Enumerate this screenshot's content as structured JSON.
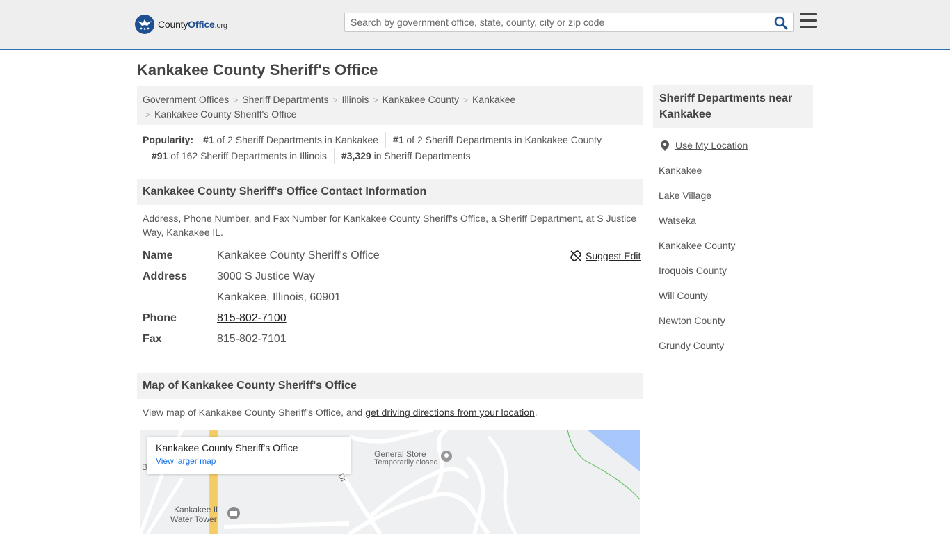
{
  "header": {
    "logo_county": "County",
    "logo_office": "Office",
    "logo_tld": ".org",
    "search_placeholder": "Search by government office, state, county, city or zip code"
  },
  "page_title": "Kankakee County Sheriff's Office",
  "breadcrumbs": [
    "Government Offices",
    "Sheriff Departments",
    "Illinois",
    "Kankakee County",
    "Kankakee",
    "Kankakee County Sheriff's Office"
  ],
  "popularity": {
    "label": "Popularity:",
    "items": [
      {
        "rank": "#1",
        "text": " of 2 Sheriff Departments in Kankakee"
      },
      {
        "rank": "#1",
        "text": " of 2 Sheriff Departments in Kankakee County"
      },
      {
        "rank": "#91",
        "text": " of 162 Sheriff Departments in Illinois"
      },
      {
        "rank": "#3,329",
        "text": " in Sheriff Departments"
      }
    ]
  },
  "contact": {
    "heading": "Kankakee County Sheriff's Office Contact Information",
    "description": "Address, Phone Number, and Fax Number for Kankakee County Sheriff's Office, a Sheriff Department, at S Justice Way, Kankakee IL.",
    "suggest_edit": "Suggest Edit",
    "name_label": "Name",
    "name_value": "Kankakee County Sheriff's Office",
    "address_label": "Address",
    "address_line1": "3000 S Justice Way",
    "address_line2": "Kankakee, Illinois, 60901",
    "phone_label": "Phone",
    "phone_value": "815-802-7100",
    "fax_label": "Fax",
    "fax_value": "815-802-7101"
  },
  "map_section": {
    "heading": "Map of Kankakee County Sheriff's Office",
    "desc_prefix": "View map of Kankakee County Sheriff's Office, and ",
    "desc_link": "get driving directions from your location",
    "desc_suffix": ".",
    "card_title": "Kankakee County Sheriff's Office",
    "card_link": "View larger map",
    "label_store": "General Store",
    "label_store_status": "Temporarily closed",
    "label_tower_1": "Kankakee IL",
    "label_tower_2": "Water Tower",
    "label_road": "Dr",
    "label_edge": "B"
  },
  "sidebar": {
    "heading": "Sheriff Departments near Kankakee",
    "use_location": "Use My Location",
    "links": [
      "Kankakee",
      "Lake Village",
      "Watseka",
      "Kankakee County",
      "Iroquois County",
      "Will County",
      "Newton County",
      "Grundy County"
    ]
  },
  "colors": {
    "header_bg": "#eeeeee",
    "brand_blue": "#1d4f91",
    "header_border": "#2f6fb3",
    "panel_bg": "#f2f2f2"
  }
}
